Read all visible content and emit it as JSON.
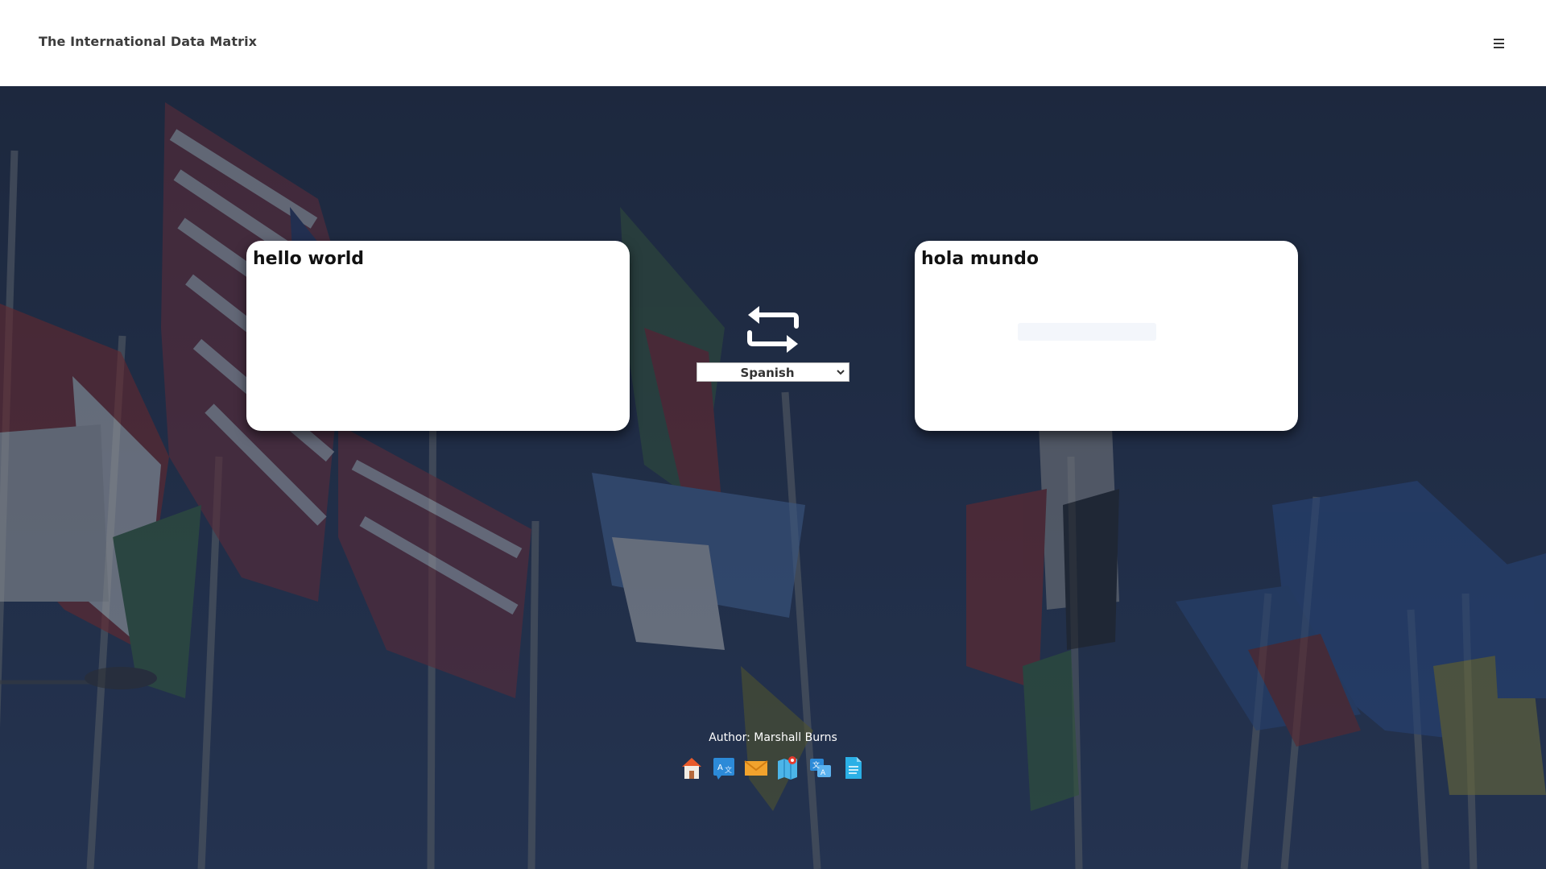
{
  "header": {
    "brand": "The International Data Matrix",
    "menu_icon": "hamburger-menu-icon"
  },
  "source": {
    "text": "hello world"
  },
  "target": {
    "text": "hola mundo"
  },
  "controls": {
    "swap_icon": "swap-arrows-icon",
    "language": "Spanish"
  },
  "footer": {
    "author": "Author: Marshall Burns",
    "icons": [
      "home-icon",
      "translate-icon",
      "mail-icon",
      "map-icon",
      "language-search-icon",
      "document-icon"
    ]
  },
  "colors": {
    "header_bg": "#ffffff",
    "hero_overlay": "#233049",
    "card_bg": "#ffffff"
  }
}
